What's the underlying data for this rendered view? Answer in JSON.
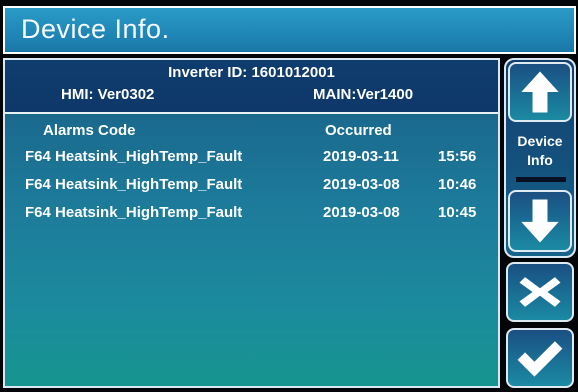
{
  "header": {
    "title": "Device Info."
  },
  "device": {
    "inverter_id": "Inverter ID: 1601012001",
    "hmi_version": "HMI: Ver0302",
    "main_version": "MAIN:Ver1400"
  },
  "alarms": {
    "columns": {
      "code": "Alarms Code",
      "occurred": "Occurred"
    },
    "rows": [
      {
        "code": "F64 Heatsink_HighTemp_Fault",
        "date": "2019-03-11",
        "time": "15:56"
      },
      {
        "code": "F64 Heatsink_HighTemp_Fault",
        "date": "2019-03-08",
        "time": "10:46"
      },
      {
        "code": "F64 Heatsink_HighTemp_Fault",
        "date": "2019-03-08",
        "time": "10:45"
      }
    ]
  },
  "side": {
    "device_info_label_1": "Device",
    "device_info_label_2": "Info",
    "up_icon": "arrow-up-icon",
    "down_icon": "arrow-down-icon",
    "cancel_icon": "close-icon",
    "ok_icon": "check-icon"
  },
  "colors": {
    "title_bar": "#1f86b6",
    "info_band": "#0f3d6e",
    "panel_top": "#15567a",
    "panel_bottom": "#16958f"
  }
}
